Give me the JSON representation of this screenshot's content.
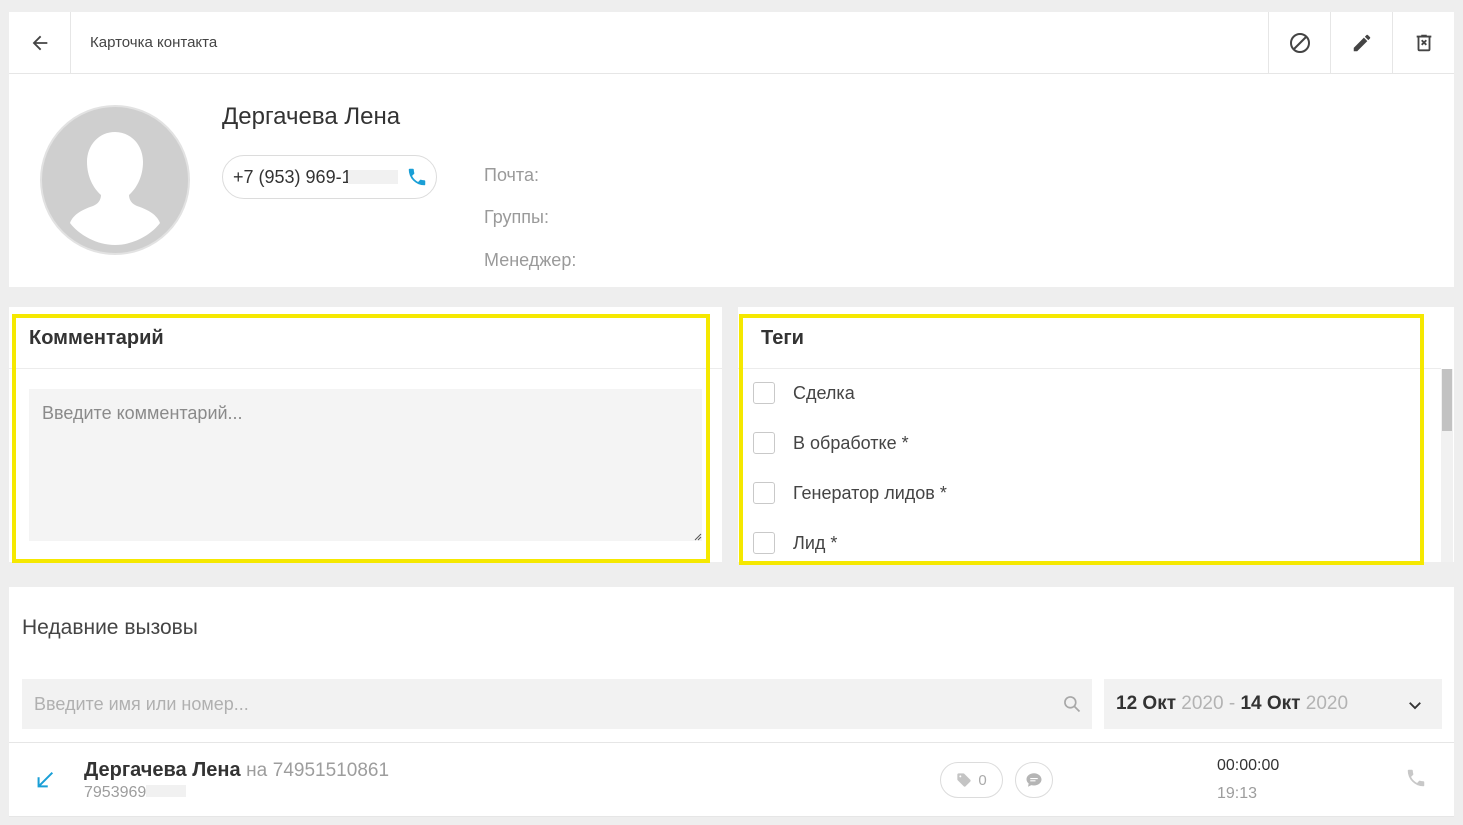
{
  "header": {
    "title": "Карточка контакта",
    "icons": [
      "back-arrow-icon",
      "block-icon",
      "edit-pencil-icon",
      "delete-icon"
    ]
  },
  "contact": {
    "name": "Дергачева Лена",
    "phone_visible": "+7 (953) 969-1",
    "labels": {
      "email": "Почта:",
      "groups": "Группы:",
      "manager": "Менеджер:"
    }
  },
  "comment": {
    "title": "Комментарий",
    "placeholder": "Введите комментарий..."
  },
  "tags": {
    "title": "Теги",
    "items": [
      {
        "label": "Сделка",
        "checked": false
      },
      {
        "label": "В обработке *",
        "checked": false
      },
      {
        "label": "Генератор лидов *",
        "checked": false
      },
      {
        "label": "Лид *",
        "checked": false
      }
    ]
  },
  "recent_calls": {
    "title": "Недавние вызовы",
    "search_placeholder": "Введите имя или номер...",
    "date_range": {
      "from_day": "12 Окт",
      "from_year": "2020",
      "separator": "-",
      "to_day": "14 Окт",
      "to_year": "2020"
    },
    "calls": [
      {
        "name": "Дергачева Лена",
        "to_prefix": "на",
        "to_number": "74951510861",
        "number_visible": "7953969",
        "tag_count": "0",
        "duration": "00:00:00",
        "time": "19:13",
        "direction": "incoming"
      }
    ]
  },
  "colors": {
    "accent": "#1a9fd6",
    "highlight": "#f5e800",
    "avatar_bg": "#cfcfcf"
  }
}
